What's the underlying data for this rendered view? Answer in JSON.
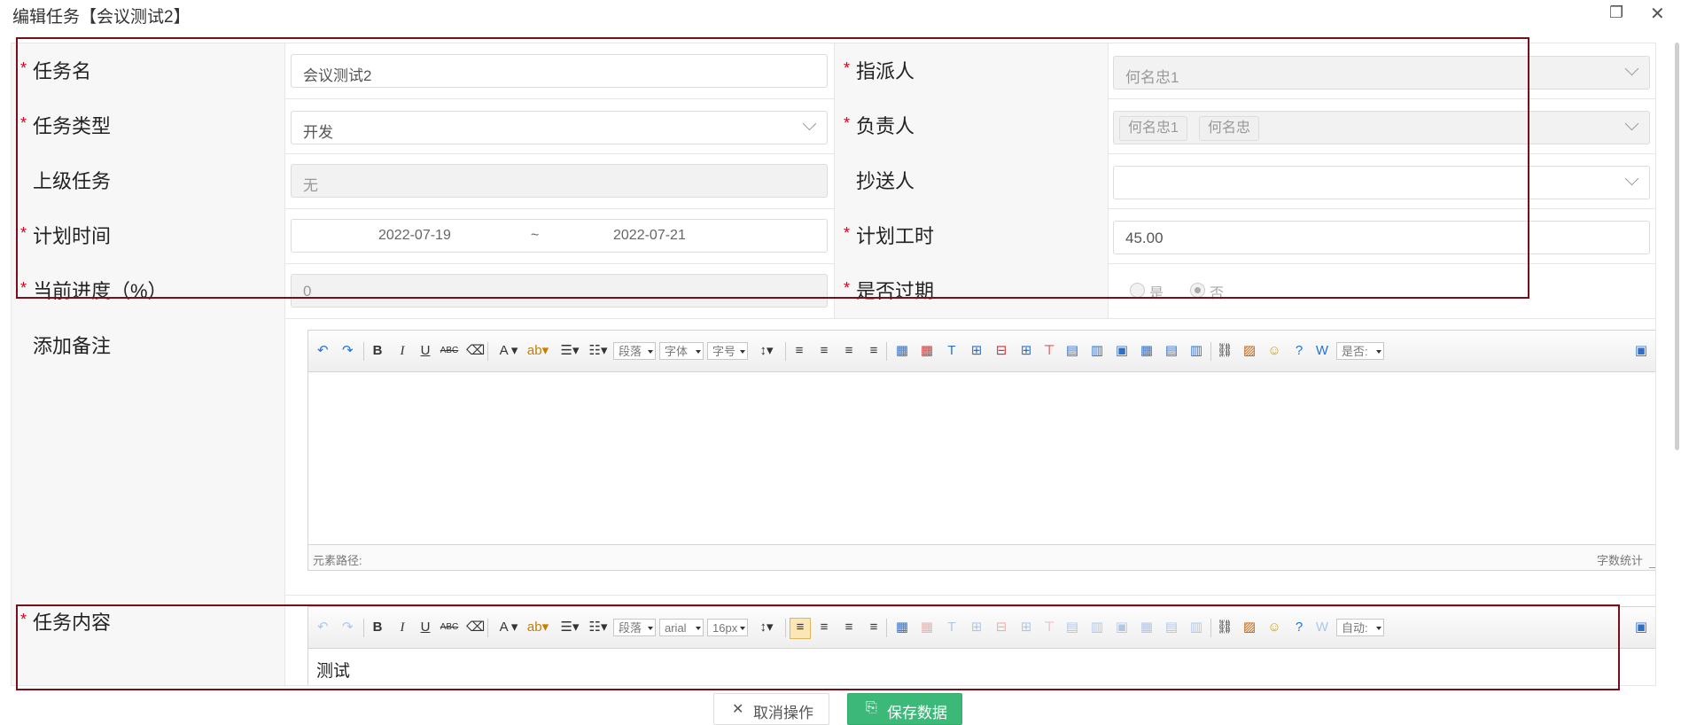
{
  "window": {
    "title": "编辑任务【会议测试2】"
  },
  "form": {
    "task_name": {
      "label": "任务名",
      "value": "会议测试2"
    },
    "assigner": {
      "label": "指派人",
      "value": "何名忠1"
    },
    "task_type": {
      "label": "任务类型",
      "value": "开发"
    },
    "owner": {
      "label": "负责人",
      "tags": [
        "何名忠1",
        "何名忠"
      ]
    },
    "parent_task": {
      "label": "上级任务",
      "value": "无"
    },
    "cc": {
      "label": "抄送人",
      "value": ""
    },
    "plan_time": {
      "label": "计划时间",
      "start": "2022-07-19",
      "separator": "~",
      "end": "2022-07-21"
    },
    "plan_hours": {
      "label": "计划工时",
      "value": "45.00"
    },
    "progress": {
      "label": "当前进度（%）",
      "value": "0"
    },
    "overdue": {
      "label": "是否过期",
      "options": [
        "是",
        "否"
      ],
      "selected": "否"
    },
    "remark": {
      "label": "添加备注"
    },
    "content": {
      "label": "任务内容",
      "value": "测试"
    }
  },
  "editor1": {
    "selects": {
      "paragraph": "段落",
      "font": "字体",
      "size": "字号",
      "auto": "是否:"
    },
    "status_path": "元素路径:",
    "status_count": "字数统计"
  },
  "editor2": {
    "selects": {
      "paragraph": "段落",
      "font": "arial",
      "size": "16px",
      "auto": "自动:"
    }
  },
  "footer": {
    "cancel_label": "取消操作",
    "save_label": "保存数据"
  },
  "colors": {
    "required": "#d9001b",
    "highlight": "#7a0f1c",
    "save_bg": "#3cb878"
  }
}
